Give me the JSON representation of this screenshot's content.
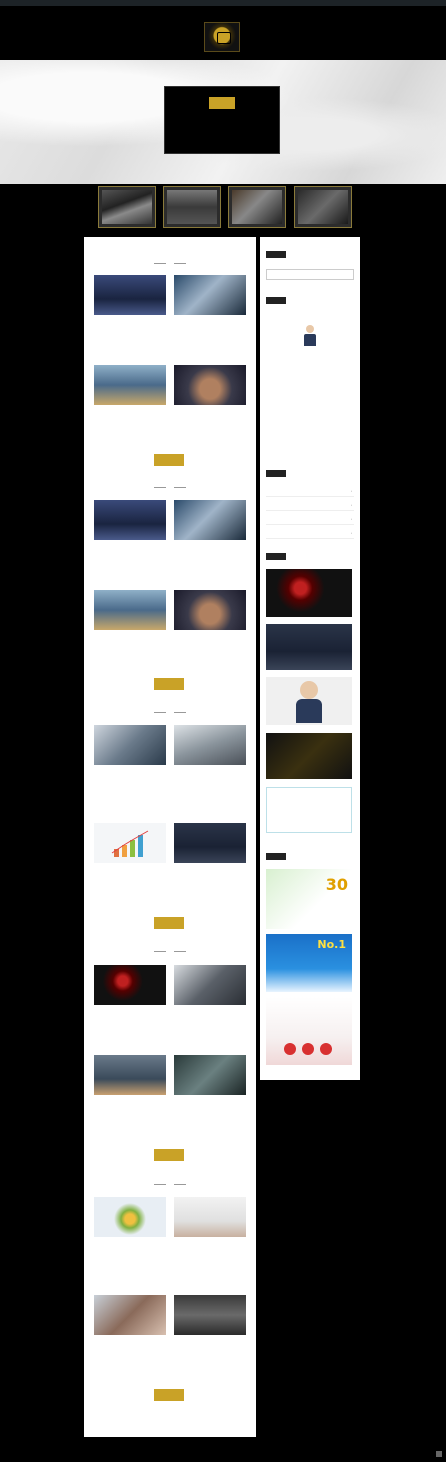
{
  "adminbar": {
    "items": [
      "",
      "",
      "",
      ""
    ],
    "right": ""
  },
  "nav": {
    "items": [
      "",
      "",
      "",
      ""
    ]
  },
  "hero": {
    "title": "",
    "subtitle_line1": "",
    "subtitle_line2": "",
    "button": ""
  },
  "main": {
    "sections": [
      {
        "heading": "",
        "button": "",
        "cards": [
          {
            "title": "",
            "excerpt": "",
            "date": ""
          },
          {
            "title": "",
            "excerpt": "",
            "date": ""
          },
          {
            "title": "",
            "excerpt": "",
            "date": ""
          },
          {
            "title": "",
            "excerpt": "",
            "date": ""
          }
        ]
      },
      {
        "heading": "",
        "button": "",
        "cards": [
          {
            "title": "",
            "excerpt": "",
            "date": ""
          },
          {
            "title": "",
            "excerpt": "",
            "date": ""
          },
          {
            "title": "",
            "excerpt": "",
            "date": ""
          },
          {
            "title": "",
            "excerpt": "",
            "date": ""
          }
        ]
      },
      {
        "heading": "",
        "button": "",
        "cards": [
          {
            "title": "",
            "excerpt": "",
            "date": ""
          },
          {
            "title": "",
            "excerpt": "",
            "date": ""
          },
          {
            "title": "",
            "excerpt": "",
            "date": ""
          },
          {
            "title": "",
            "excerpt": "",
            "date": ""
          }
        ]
      },
      {
        "heading": "",
        "button": "",
        "cards": [
          {
            "title": "",
            "excerpt": "",
            "date": ""
          },
          {
            "title": "",
            "excerpt": "",
            "date": ""
          },
          {
            "title": "",
            "excerpt": "",
            "date": ""
          },
          {
            "title": "",
            "excerpt": "",
            "date": ""
          }
        ]
      },
      {
        "heading": "",
        "button": "",
        "cards": [
          {
            "title": "",
            "excerpt": "",
            "date": ""
          },
          {
            "title": "",
            "excerpt": "",
            "date": ""
          },
          {
            "title": "",
            "excerpt": "",
            "date": ""
          },
          {
            "title": "",
            "excerpt": "",
            "date": ""
          }
        ]
      }
    ]
  },
  "sidebar": {
    "search_title": "",
    "search_placeholder": "",
    "profile_title": "",
    "profile_name": "",
    "profile_text": "",
    "category_title": "",
    "categories": [
      "",
      "",
      "",
      ""
    ],
    "recent_title": "",
    "ads_title": "",
    "ad_badge_1": "30",
    "ad_badge_2": "No.1"
  },
  "footer": {
    "left": "",
    "center": "",
    "right": ""
  },
  "colors": {
    "accent": "#c9a227",
    "background": "#000000",
    "panel": "#ffffff"
  }
}
